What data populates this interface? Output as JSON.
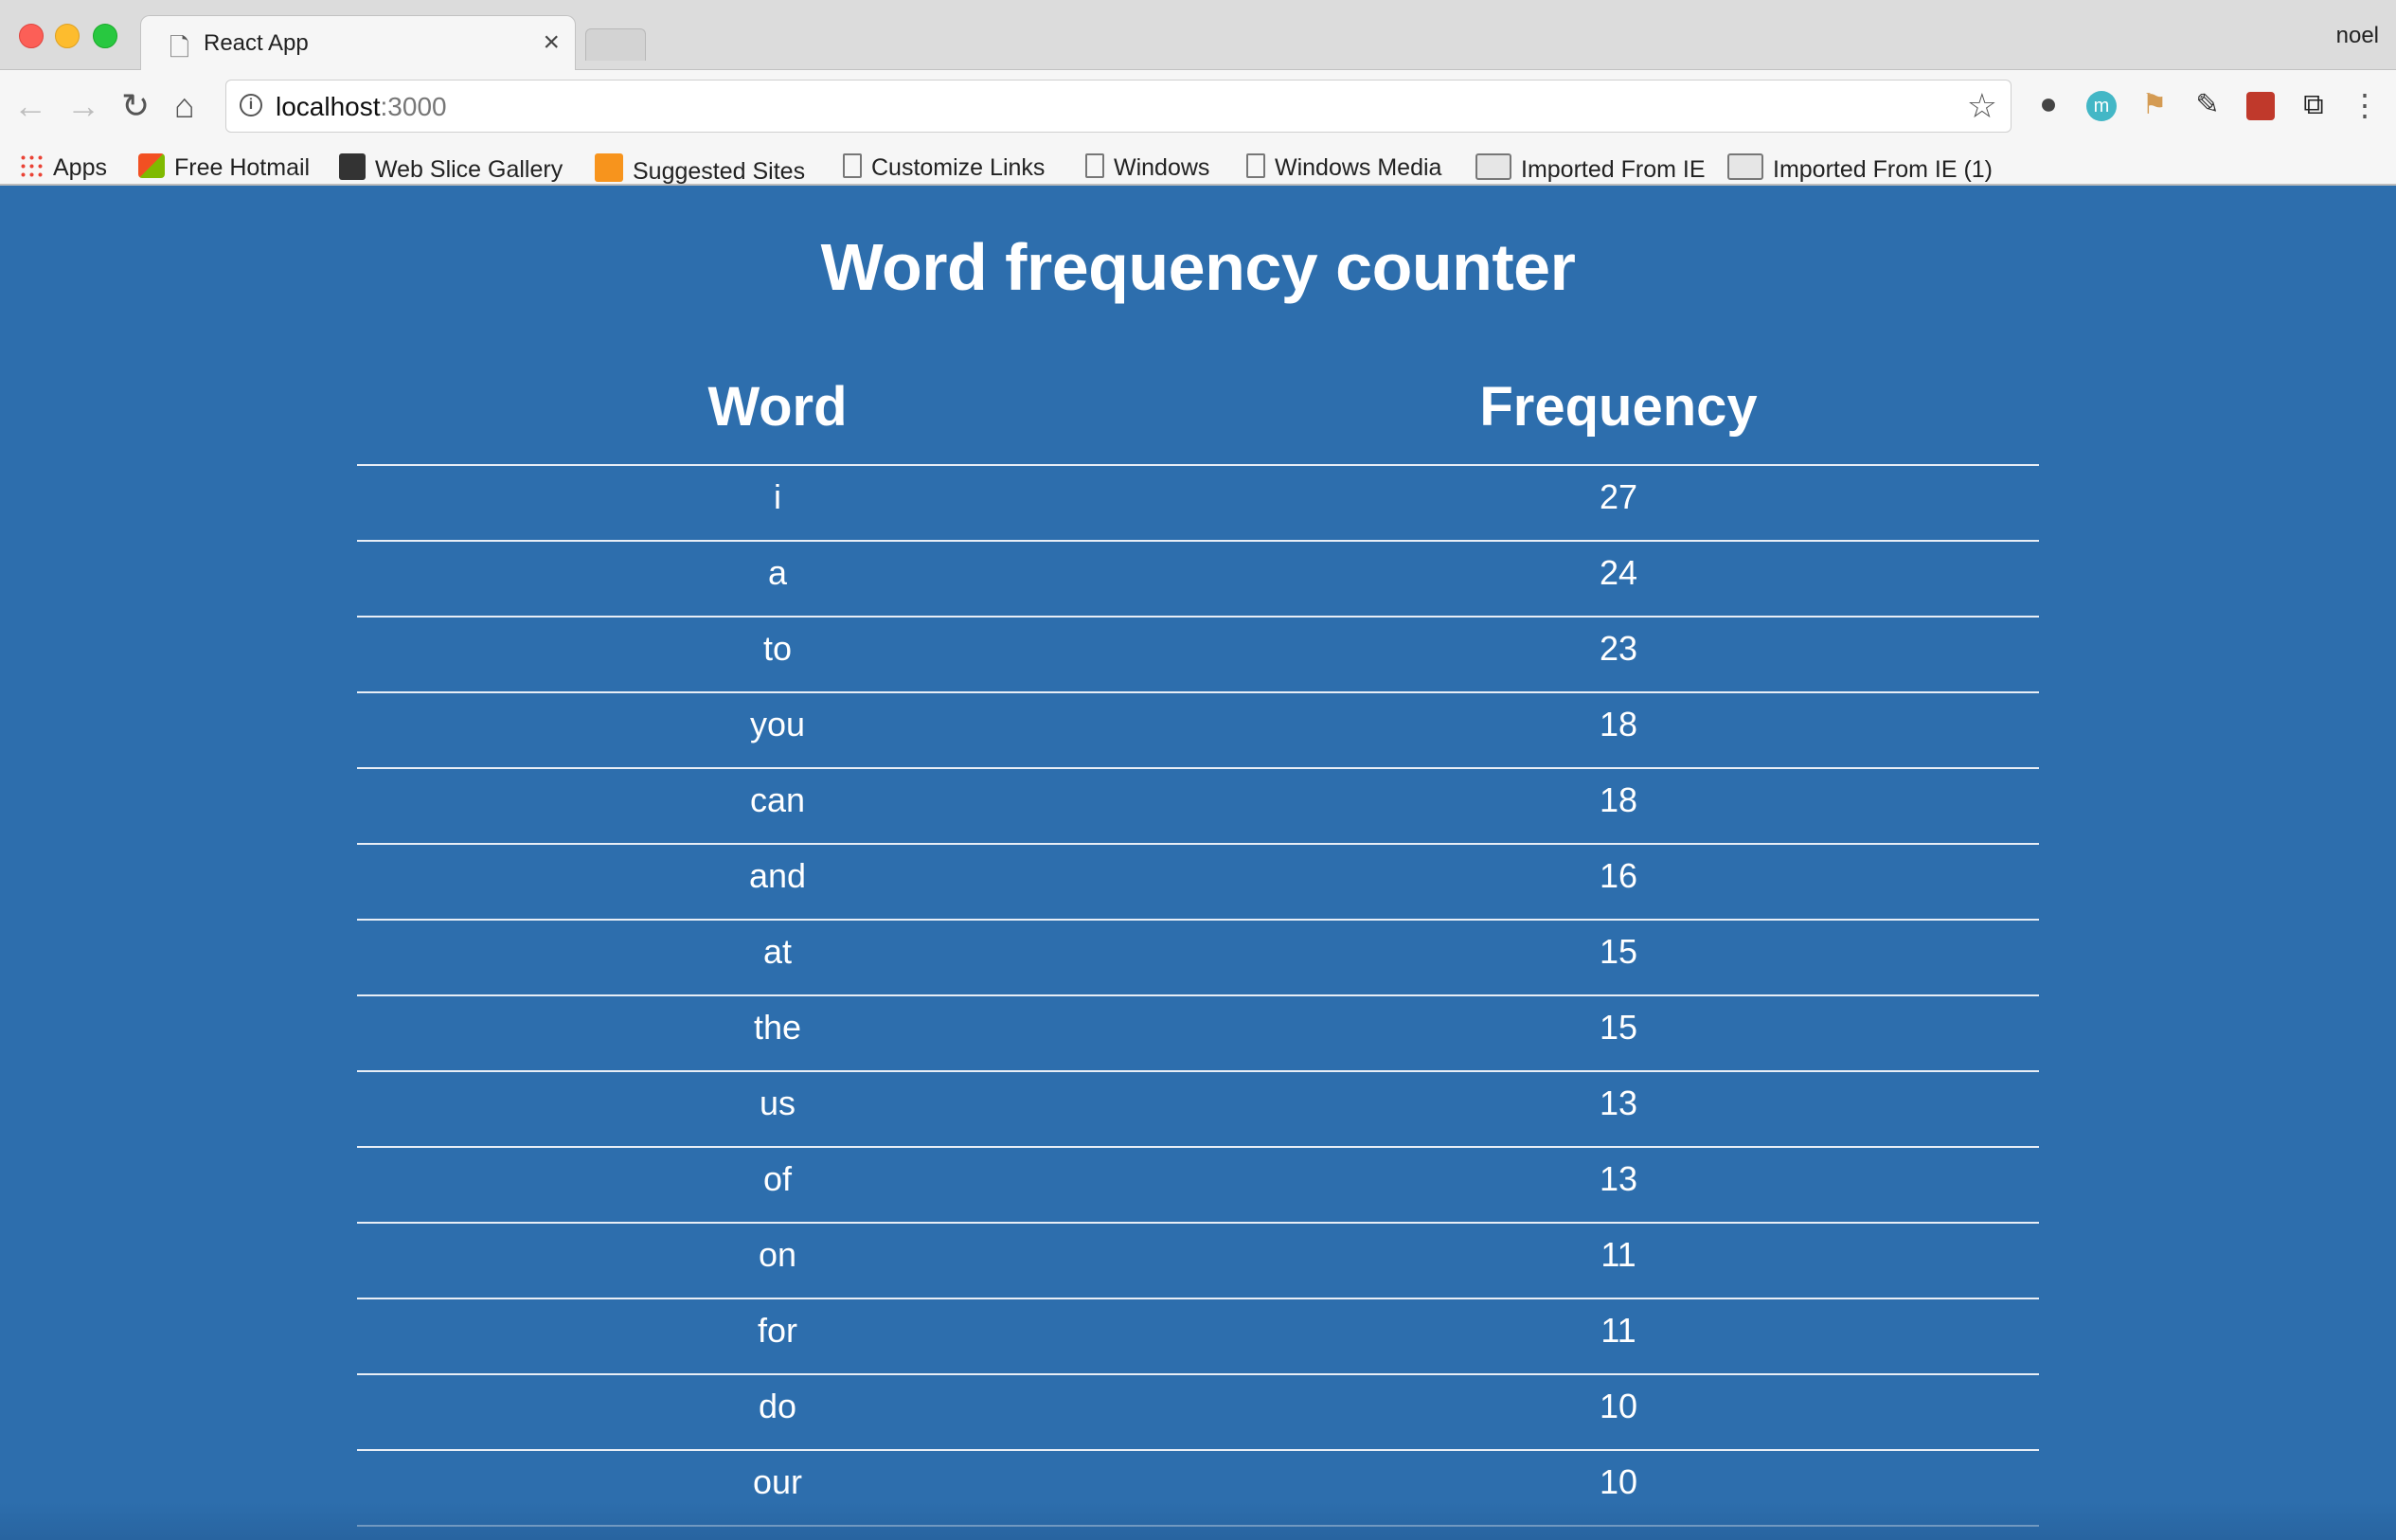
{
  "window": {
    "tab_title": "React App",
    "tab_close": "×",
    "profile_name": "noel"
  },
  "toolbar": {
    "url_host": "localhost",
    "url_port": ":3000",
    "back_icon": "←",
    "forward_icon": "→",
    "reload_icon": "↻",
    "home_icon": "⌂",
    "star_icon": "☆",
    "menu_icon": "⋮"
  },
  "bookmarks": [
    {
      "label": "Apps",
      "icon": "apps-grid-icon"
    },
    {
      "label": "Free Hotmail",
      "icon": "windows-flag-icon"
    },
    {
      "label": "Web Slice Gallery",
      "icon": "slice-icon"
    },
    {
      "label": "Suggested Sites",
      "icon": "lightbulb-icon"
    },
    {
      "label": "Customize Links",
      "icon": "page-icon"
    },
    {
      "label": "Windows",
      "icon": "page-icon"
    },
    {
      "label": "Windows Media",
      "icon": "page-icon"
    },
    {
      "label": "Imported From IE",
      "icon": "folder-icon"
    },
    {
      "label": "Imported From IE (1)",
      "icon": "folder-icon"
    }
  ],
  "main": {
    "title": "Word frequency counter",
    "columns": [
      "Word",
      "Frequency"
    ],
    "rows": [
      {
        "word": "i",
        "frequency": "27"
      },
      {
        "word": "a",
        "frequency": "24"
      },
      {
        "word": "to",
        "frequency": "23"
      },
      {
        "word": "you",
        "frequency": "18"
      },
      {
        "word": "can",
        "frequency": "18"
      },
      {
        "word": "and",
        "frequency": "16"
      },
      {
        "word": "at",
        "frequency": "15"
      },
      {
        "word": "the",
        "frequency": "15"
      },
      {
        "word": "us",
        "frequency": "13"
      },
      {
        "word": "of",
        "frequency": "13"
      },
      {
        "word": "on",
        "frequency": "11"
      },
      {
        "word": "for",
        "frequency": "11"
      },
      {
        "word": "do",
        "frequency": "10"
      },
      {
        "word": "our",
        "frequency": "10"
      }
    ]
  },
  "colors": {
    "page_background": "#2d6ead",
    "text": "#ffffff"
  }
}
